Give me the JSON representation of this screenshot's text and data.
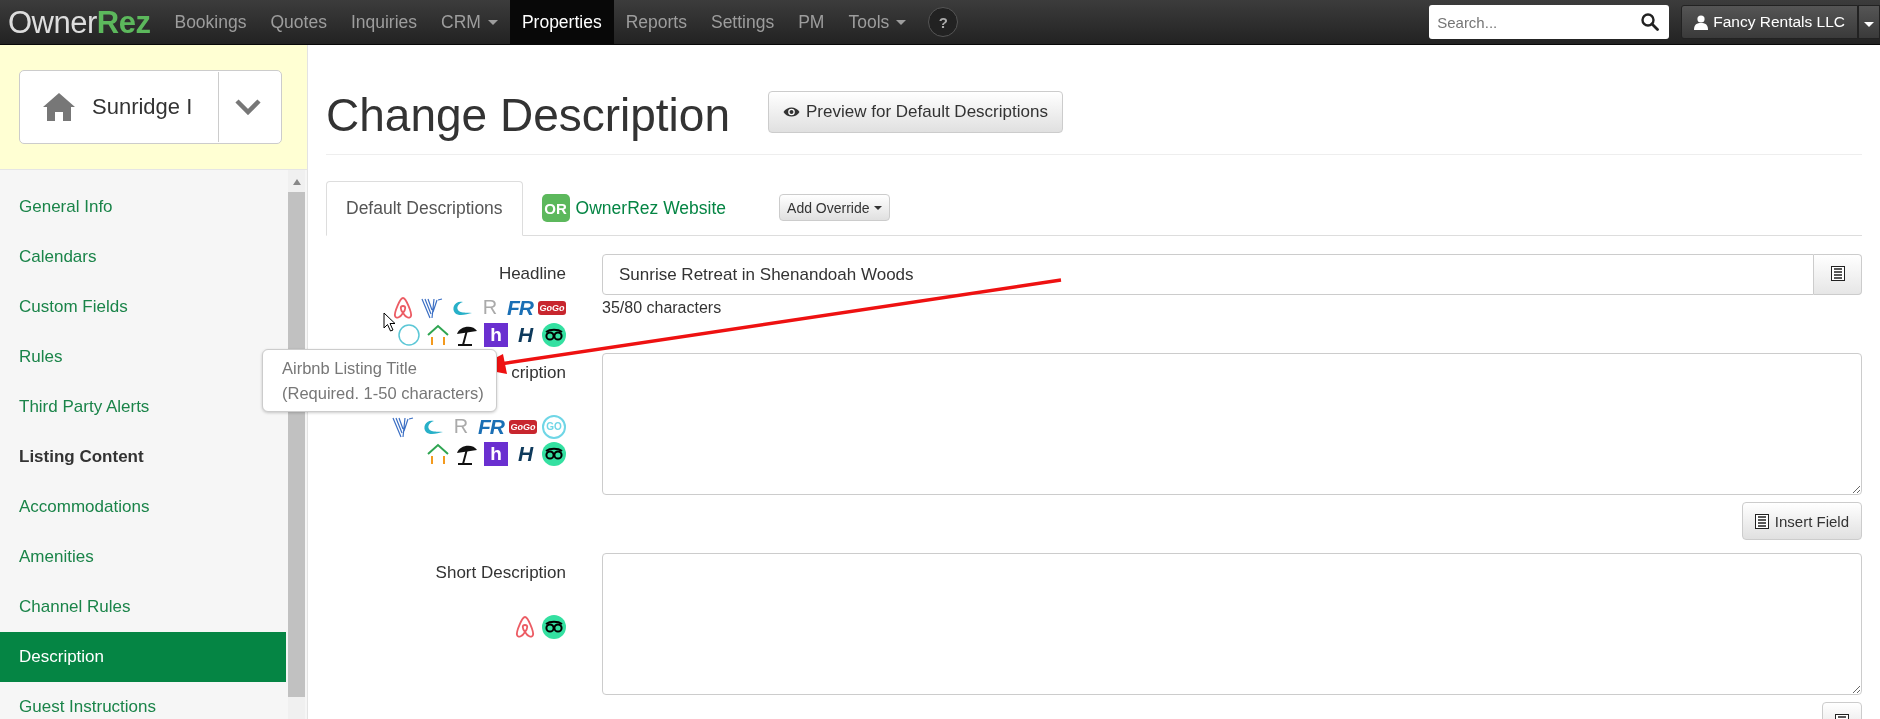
{
  "navbar": {
    "logo": {
      "part_1": "Owner",
      "part_2": "Rez"
    },
    "items": [
      {
        "label": "Bookings",
        "selected": false,
        "dropdown": false
      },
      {
        "label": "Quotes",
        "selected": false,
        "dropdown": false
      },
      {
        "label": "Inquiries",
        "selected": false,
        "dropdown": false
      },
      {
        "label": "CRM",
        "selected": false,
        "dropdown": true
      },
      {
        "label": "Properties",
        "selected": true,
        "dropdown": false
      },
      {
        "label": "Reports",
        "selected": false,
        "dropdown": false
      },
      {
        "label": "Settings",
        "selected": false,
        "dropdown": false
      },
      {
        "label": "PM",
        "selected": false,
        "dropdown": false
      },
      {
        "label": "Tools",
        "selected": false,
        "dropdown": true
      }
    ],
    "help": "?",
    "search": {
      "placeholder": "Search..."
    },
    "account": "Fancy Rentals LLC"
  },
  "sidebar": {
    "property": "Sunridge I",
    "items": [
      {
        "label": "General Info",
        "kind": "link",
        "selected": false
      },
      {
        "label": "Calendars",
        "kind": "link",
        "selected": false
      },
      {
        "label": "Custom Fields",
        "kind": "link",
        "selected": false
      },
      {
        "label": "Rules",
        "kind": "link",
        "selected": false
      },
      {
        "label": "Third Party Alerts",
        "kind": "link",
        "selected": false
      },
      {
        "label": "Listing Content",
        "kind": "heading"
      },
      {
        "label": "Accommodations",
        "kind": "link",
        "selected": false
      },
      {
        "label": "Amenities",
        "kind": "link",
        "selected": false
      },
      {
        "label": "Channel Rules",
        "kind": "link",
        "selected": false
      },
      {
        "label": "Description",
        "kind": "link",
        "selected": true
      },
      {
        "label": "Guest Instructions",
        "kind": "link",
        "selected": false
      }
    ]
  },
  "page": {
    "title": "Change Description",
    "preview_button": "Preview for Default Descriptions",
    "tabs": [
      {
        "label": "Default Descriptions",
        "selected": true
      },
      {
        "label": "OwnerRez Website",
        "selected": false,
        "badge": "OR"
      }
    ],
    "override_button": "Add Override",
    "fields": [
      {
        "label": "Headline",
        "kind": "input",
        "value": "Sunrise Retreat in Shenandoah Woods",
        "counter": "35/80 characters",
        "icon_rows": [
          [
            {
              "kind": "loop"
            },
            {
              "kind": "stripes"
            },
            {
              "kind": "wave"
            },
            {
              "kind": "thin",
              "text": "R"
            },
            {
              "kind": "letters",
              "text": "FR",
              "color": "#1a6fb5"
            },
            {
              "kind": "tag",
              "text": "GoGo",
              "color": "#c8262e"
            }
          ],
          [
            {
              "kind": "globe"
            },
            {
              "kind": "house"
            },
            {
              "kind": "umbrella"
            },
            {
              "kind": "tile",
              "text": "h",
              "color": "#6a2fd0"
            },
            {
              "kind": "letters",
              "text": "H",
              "color": "#0e3a5c"
            },
            {
              "kind": "owl"
            }
          ]
        ]
      },
      {
        "label": "cription",
        "kind": "textarea",
        "button": "Insert Field",
        "icon_rows": [
          [
            {
              "kind": "stripes"
            },
            {
              "kind": "wave"
            },
            {
              "kind": "thin",
              "text": "R"
            },
            {
              "kind": "letters",
              "text": "FR",
              "color": "#1a6fb5"
            },
            {
              "kind": "tag",
              "text": "GoGo",
              "color": "#c8262e"
            },
            {
              "kind": "ring",
              "text": "GO",
              "color": "#6fd6e6"
            }
          ],
          [
            {
              "kind": "house"
            },
            {
              "kind": "umbrella"
            },
            {
              "kind": "tile",
              "text": "h",
              "color": "#6a2fd0"
            },
            {
              "kind": "letters",
              "text": "H",
              "color": "#0e3a5c"
            },
            {
              "kind": "owl"
            }
          ]
        ]
      },
      {
        "label": "Short Description",
        "kind": "textarea",
        "icon_rows": [
          [
            {
              "kind": "loop"
            },
            {
              "kind": "owl"
            }
          ]
        ]
      }
    ],
    "tooltip": {
      "title": "Airbnb Listing Title",
      "detail": "(Required. 1-50 characters)"
    }
  }
}
